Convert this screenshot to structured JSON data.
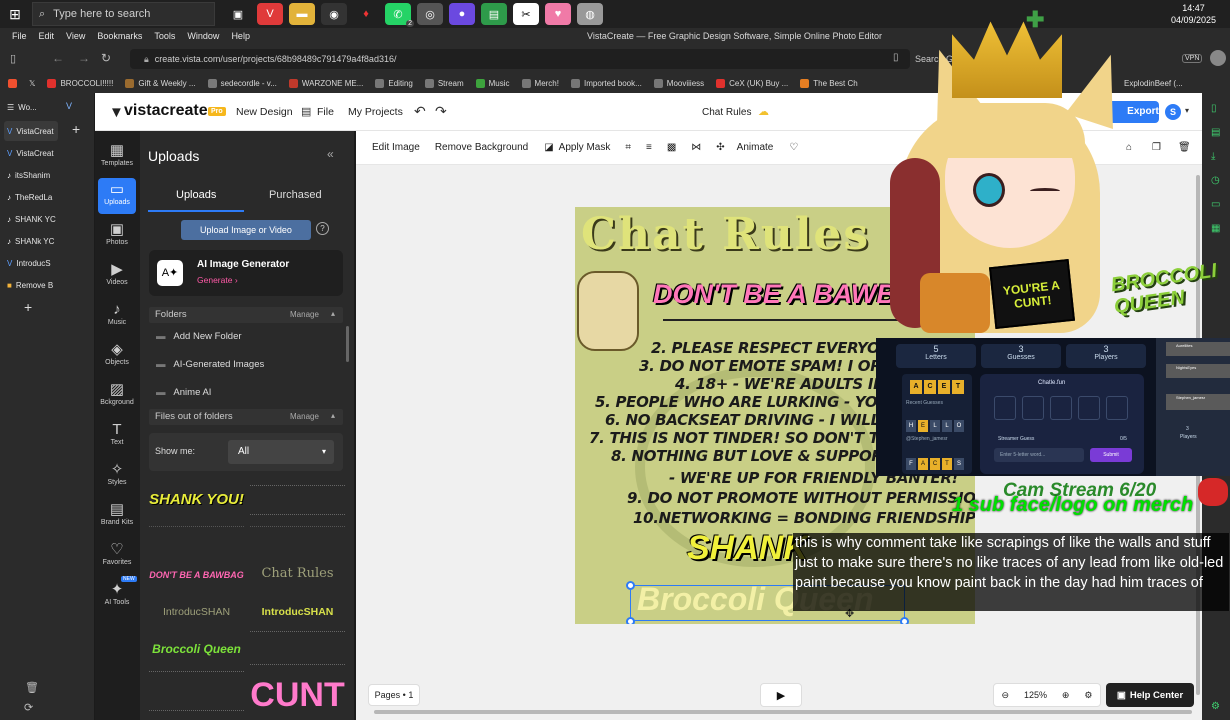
{
  "taskbar": {
    "search_placeholder": "Type here to search",
    "clock_time": "14:47",
    "clock_date": "04/09/2025",
    "badge_count": "2"
  },
  "browser": {
    "menu": [
      "File",
      "Edit",
      "View",
      "Bookmarks",
      "Tools",
      "Window",
      "Help"
    ],
    "window_title": "VistaCreate — Free Graphic Design Software, Simple Online Photo Editor",
    "url": "create.vista.com/user/projects/68b98489c791479a4f8ad316/",
    "search_snippet": "Search Goo",
    "vpn": "VPN",
    "bookmarks": [
      {
        "label": "BROCCOLI!!!!!",
        "color": "#e0312d"
      },
      {
        "label": "Gift & Weekly ...",
        "color": "#9a6b2f"
      },
      {
        "label": "sedecordle - v...",
        "color": "#7a7a7a"
      },
      {
        "label": "WARZONE ME...",
        "color": "#c0392b"
      },
      {
        "label": "Editing",
        "color": "#777"
      },
      {
        "label": "Stream",
        "color": "#777"
      },
      {
        "label": "Music",
        "color": "#3da33d"
      },
      {
        "label": "Merch!",
        "color": "#777"
      },
      {
        "label": "Imported book...",
        "color": "#777"
      },
      {
        "label": "Mooviiiess",
        "color": "#777"
      },
      {
        "label": "CeX (UK) Buy ...",
        "color": "#e0312d"
      },
      {
        "label": "The Best Ch",
        "color": "#e67e22"
      }
    ],
    "bookmark_right": "ExplodinBeef (..."
  },
  "opera_tabs": [
    "Wo...",
    "VistaCreat",
    "VistaCreat",
    "itsShanim",
    "TheRedLa",
    "SHANK YC",
    "SHANk YC",
    "IntroducS",
    "Remove B"
  ],
  "app": {
    "logo_text": "vistacreate",
    "pro_badge": "Pro",
    "new_design": "New Design",
    "file": "File",
    "my_projects": "My Projects",
    "doc_title": "Chat Rules",
    "export": "Export",
    "avatar_initial": "S"
  },
  "rail": [
    {
      "label": "Templates",
      "icon": "templates-icon",
      "glyph": "▦"
    },
    {
      "label": "Uploads",
      "icon": "folder-icon",
      "glyph": "▭"
    },
    {
      "label": "Photos",
      "icon": "photo-icon",
      "glyph": "▣"
    },
    {
      "label": "Videos",
      "icon": "video-icon",
      "glyph": "▶"
    },
    {
      "label": "Music",
      "icon": "music-icon",
      "glyph": "♪"
    },
    {
      "label": "Objects",
      "icon": "objects-icon",
      "glyph": "◈"
    },
    {
      "label": "Bckground",
      "icon": "background-icon",
      "glyph": "▨"
    },
    {
      "label": "Text",
      "icon": "text-icon",
      "glyph": "T"
    },
    {
      "label": "Styles",
      "icon": "styles-icon",
      "glyph": "✧"
    },
    {
      "label": "Brand Kits",
      "icon": "brandkit-icon",
      "glyph": "▤"
    },
    {
      "label": "Favorites",
      "icon": "heart-icon",
      "glyph": "♡"
    },
    {
      "label": "AI Tools",
      "icon": "sparkle-icon",
      "glyph": "✦"
    }
  ],
  "rail_new_badge": "NEW",
  "panel": {
    "title": "Uploads",
    "tab_uploads": "Uploads",
    "tab_purchased": "Purchased",
    "upload_button": "Upload Image or Video",
    "ai_title": "AI Image Generator",
    "ai_generate": "Generate",
    "folders_label": "Folders",
    "manage": "Manage",
    "folders": [
      "Add New Folder",
      "AI-Generated Images",
      "Anime AI"
    ],
    "files_out_label": "Files out of folders",
    "show_me_label": "Show me:",
    "show_me_value": "All",
    "thumbs": [
      {
        "text": "SHANK YOU!",
        "color": "#e8ec3a"
      },
      {
        "text": "",
        "color": "#777"
      },
      {
        "text": "",
        "color": "#777"
      },
      {
        "text": "",
        "color": "#777"
      },
      {
        "text": "DON'T BE A BAWBAG",
        "color": "#ff66b2"
      },
      {
        "text": "Chat Rules",
        "color": "#9ea07a"
      },
      {
        "text": "IntroducSHAN",
        "color": "#9ea07a"
      },
      {
        "text": "IntroducSHAN",
        "color": "#d7e04a"
      },
      {
        "text": "Broccoli Queen",
        "color": "#7ce23a"
      },
      {
        "text": "",
        "color": "#777"
      },
      {
        "text": "",
        "color": "#777"
      },
      {
        "text": "CUNT",
        "color": "#ff7acb"
      }
    ]
  },
  "edit_toolbar": {
    "edit_image": "Edit Image",
    "remove_background": "Remove Background",
    "apply_mask": "Apply Mask",
    "animate": "Animate"
  },
  "artboard": {
    "title": "Chat Rules",
    "banner": "DON'T BE A BAWBAG",
    "rules": [
      "2. PLEASE RESPECT EVERYONE IN C",
      "3. DO NOT EMOTE SPAM! I OR 2 IS EN",
      "4. 18+ - WE'RE ADULTS IN HERE",
      "5. PEOPLE WHO ARE LURKING - YOU ARE W",
      "6. NO BACKSEAT DRIVING - I WILL AS",
      "7. THIS IS NOT TINDER! SO DON'T TRY TO",
      "8. NOTHING BUT LOVE & SUPPORT IN",
      "- WE'RE UP FOR FRIENDLY BANTER!",
      "9. DO NOT PROMOTE WITHOUT PERMISSION.",
      "10.NETWORKING = BONDING FRIENDSHIPS!"
    ],
    "shank": "SHANK",
    "broccoli": "Broccoli Queen"
  },
  "overlay": {
    "crown_text": "YOU'RE A CUNT!",
    "broccoli_queen": "BROCCOLI QUEEN",
    "cam_stream": "Cam Stream 6/20",
    "merch": "1 sub face/logo on merch",
    "caption": "this is why comment take like scrapings of like the walls and stuff just to make sure there's no like traces of any lead from like old-led paint because you know paint back in the day had him traces of"
  },
  "chat_app": {
    "stat1_num": "5",
    "stat1_label": "Letters",
    "stat2_num": "3",
    "stat2_label": "Guesses",
    "stat3_num": "3",
    "stat3_label": "Players",
    "brand": "Chatle.fun",
    "recent": "Recent Guesses",
    "tiles": [
      "A",
      "C",
      "E",
      "T"
    ],
    "row2": [
      "H",
      "E",
      "L",
      "L",
      "O"
    ],
    "user1": "@Stephen_jamesr",
    "row3": [
      "F",
      "A",
      "C",
      "T",
      "S"
    ],
    "guess_label": "Streamer Guess",
    "guess_count": "0/5",
    "input_placeholder": "Enter 5-letter word...",
    "submit": "Submit",
    "players_label": "Players",
    "players_num": "3",
    "side_names": [
      "Aurellites",
      "NightsEyes",
      "Stephen_jamesr"
    ]
  },
  "bottom": {
    "pages": "Pages • 1",
    "zoom": "125%",
    "help": "Help Center"
  }
}
